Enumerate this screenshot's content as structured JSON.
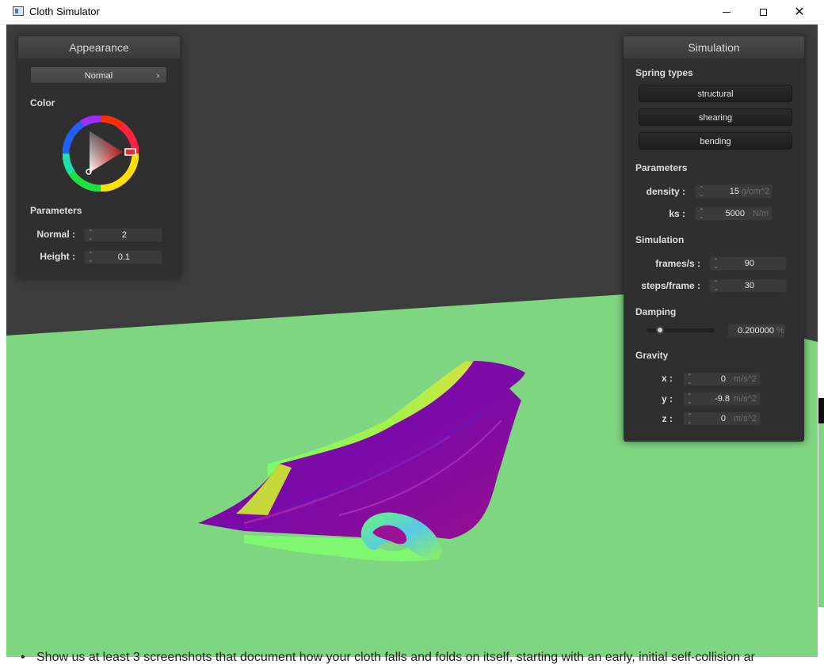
{
  "window": {
    "title": "Cloth Simulator"
  },
  "colors": {
    "background": "#3c3c3c",
    "ground": "#7fd680",
    "cloth_primary": "#8e0f9a",
    "cloth_highlight": "#7dfc5e",
    "panel": "#2f2f2f",
    "color_picker_selected": "#e03030"
  },
  "appearance": {
    "header": "Appearance",
    "shader_dropdown": "Normal",
    "color_label": "Color",
    "parameters_label": "Parameters",
    "normal": {
      "label": "Normal :",
      "value": "2"
    },
    "height": {
      "label": "Height :",
      "value": "0.1"
    }
  },
  "simulation": {
    "header": "Simulation",
    "spring_types_label": "Spring types",
    "spring_buttons": [
      "structural",
      "shearing",
      "bending"
    ],
    "parameters_label": "Parameters",
    "density": {
      "label": "density :",
      "value": "15",
      "unit": "g/cm^2"
    },
    "ks": {
      "label": "ks :",
      "value": "5000",
      "unit": "N/m"
    },
    "simulation_label": "Simulation",
    "frames_per_s": {
      "label": "frames/s :",
      "value": "90"
    },
    "steps_per_frame": {
      "label": "steps/frame :",
      "value": "30"
    },
    "damping_label": "Damping",
    "damping": {
      "value": "0.200000",
      "unit": "%",
      "fraction": 0.2
    },
    "gravity_label": "Gravity",
    "gravity": [
      {
        "label": "x :",
        "value": "0",
        "unit": "m/s^2"
      },
      {
        "label": "y :",
        "value": "-9.8",
        "unit": "m/s^2"
      },
      {
        "label": "z :",
        "value": "0",
        "unit": "m/s^2"
      }
    ]
  },
  "page_text": {
    "bullet": "•",
    "line": "Show us at least 3 screenshots that document how your cloth falls and folds on itself, starting with an early, initial self-collision ar"
  }
}
